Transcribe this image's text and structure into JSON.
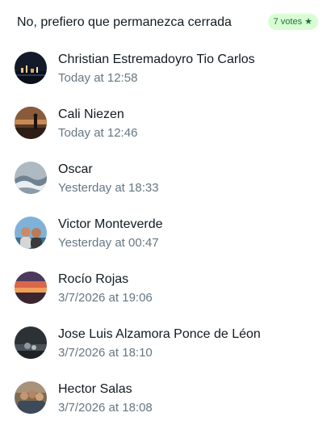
{
  "option": {
    "text": "No, prefiero que permanezca cerrada",
    "votes_badge": "7 votes ★"
  },
  "voters": [
    {
      "name": "Christian Estremadoyro Tio Carlos",
      "time": "Today at 12:58",
      "avatar": "avatar-night-city"
    },
    {
      "name": "Cali Niezen",
      "time": "Today at 12:46",
      "avatar": "avatar-sunset-figure"
    },
    {
      "name": "Oscar",
      "time": "Yesterday at 18:33",
      "avatar": "avatar-waves"
    },
    {
      "name": "Victor Monteverde",
      "time": "Yesterday at 00:47",
      "avatar": "avatar-couple-beach"
    },
    {
      "name": "Rocío Rojas",
      "time": "3/7/2026 at 19:06",
      "avatar": "avatar-sunset-sky"
    },
    {
      "name": "Jose Luis Alzamora Ponce de Léon",
      "time": "3/7/2026 at 18:10",
      "avatar": "avatar-dark-landscape"
    },
    {
      "name": "Hector Salas",
      "time": "3/7/2026 at 18:08",
      "avatar": "avatar-family-photo"
    }
  ],
  "colors": {
    "badge_bg": "#d9fdd3",
    "badge_text": "#1f6f3b",
    "secondary_text": "#667781"
  }
}
